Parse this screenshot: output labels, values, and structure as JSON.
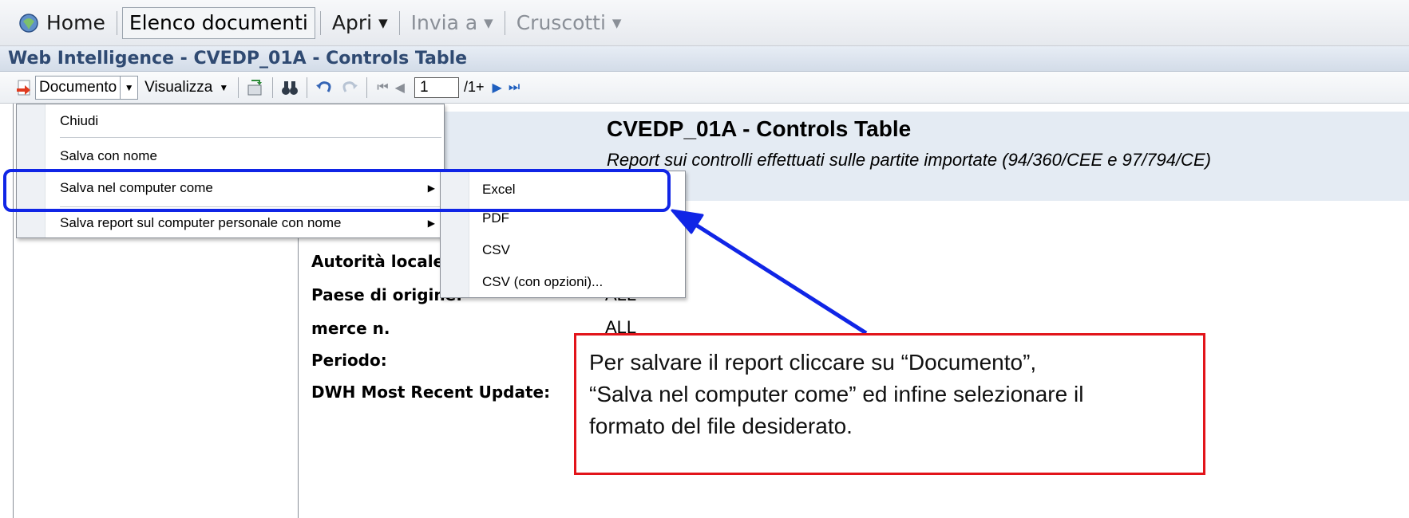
{
  "topnav": {
    "home_label": "Home",
    "documents_label": "Elenco documenti",
    "open_label": "Apri",
    "sendto_label": "Invia a",
    "dashboards_label": "Cruscotti"
  },
  "titlebar": {
    "title": "Web Intelligence - CVEDP_01A - Controls Table"
  },
  "toolbar": {
    "document_label": "Documento",
    "view_label": "Visualizza",
    "page_value": "1",
    "page_total": "/1+"
  },
  "menu": {
    "items": [
      {
        "label": "Chiudi"
      },
      {
        "label": "Salva con nome"
      },
      {
        "label": "Salva nel computer come"
      },
      {
        "label": "Salva report sul computer personale con nome"
      }
    ],
    "submenu": [
      {
        "label": "Excel"
      },
      {
        "label": "PDF"
      },
      {
        "label": "CSV"
      },
      {
        "label": "CSV (con opzioni)..."
      }
    ]
  },
  "report": {
    "title": "CVEDP_01A - Controls Table",
    "subtitle": "Report sui controlli effettuati sulle partite importate (94/360/CEE e 97/794/CE)",
    "fields": [
      {
        "label": "Autorità locale",
        "value": ""
      },
      {
        "label": "Paese di origine:",
        "value": "ALL"
      },
      {
        "label": "merce n.",
        "value": "ALL"
      },
      {
        "label": "Periodo:",
        "value": ""
      },
      {
        "label": "DWH Most Recent Update:",
        "value": ""
      }
    ]
  },
  "callout": {
    "line1": "Per salvare il report cliccare su “Documento”,",
    "line2": "“Salva nel computer come” ed infine selezionare il",
    "line3": "formato del file desiderato."
  },
  "colors": {
    "highlight": "#1025e6",
    "callout_border": "#e2141a",
    "title": "#2f4a72"
  }
}
